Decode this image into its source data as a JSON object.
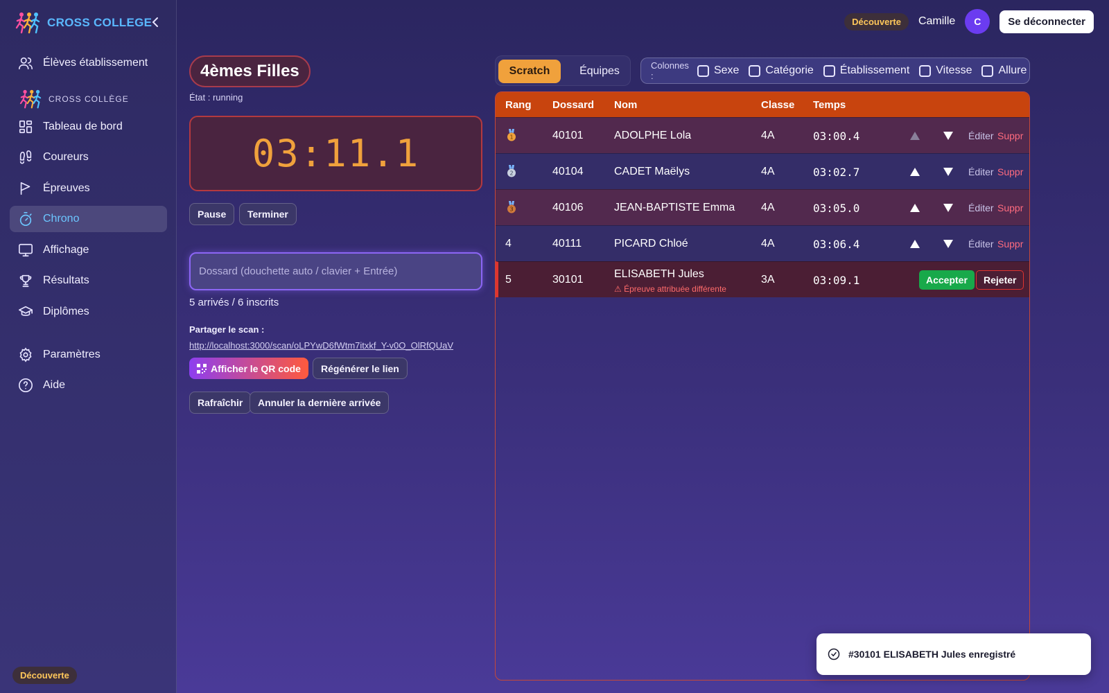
{
  "app": {
    "brand": "CROSS COLLEGE",
    "section_label": "CROSS COLLÈGE",
    "plan_badge": "Découverte"
  },
  "colors": {
    "accent_blue": "#5ab8ff",
    "accent_orange": "#f0a13c",
    "header_red": "#c8440e",
    "accept_green": "#18a94a"
  },
  "sidebar": {
    "items": [
      {
        "label": "Élèves établissement",
        "icon": "users-icon"
      },
      {
        "label": "Tableau de bord",
        "icon": "dashboard-icon"
      },
      {
        "label": "Coureurs",
        "icon": "footprints-icon"
      },
      {
        "label": "Épreuves",
        "icon": "flag-icon"
      },
      {
        "label": "Chrono",
        "icon": "stopwatch-icon",
        "active": true
      },
      {
        "label": "Affichage",
        "icon": "monitor-icon"
      },
      {
        "label": "Résultats",
        "icon": "trophy-icon"
      },
      {
        "label": "Diplômes",
        "icon": "graduation-cap-icon"
      },
      {
        "label": "Paramètres",
        "icon": "gear-icon"
      },
      {
        "label": "Aide",
        "icon": "help-circle-icon"
      }
    ]
  },
  "topbar": {
    "plan_badge": "Découverte",
    "user_name": "Camille",
    "avatar_initial": "C",
    "logout_label": "Se déconnecter"
  },
  "race": {
    "title": "4èmes Filles",
    "state": "État : running",
    "timer": "03:11.1",
    "pause_label": "Pause",
    "finish_label": "Terminer",
    "bib_placeholder": "Dossard (douchette auto / clavier + Entrée)",
    "arrivals": "5 arrivés / 6 inscrits",
    "share_label": "Partager le scan :",
    "share_link": "http://localhost:3000/scan/oLPYwD6fWtm7itxkf_Y-v0O_OlRfQUaV",
    "qr_label": "Afficher le QR code",
    "regen_label": "Régénérer le lien",
    "refresh_label": "Rafraîchir",
    "undo_label": "Annuler la dernière arrivée"
  },
  "results": {
    "tabs": [
      "Scratch",
      "Équipes"
    ],
    "columns_label": "Colonnes :",
    "column_options": [
      "Sexe",
      "Catégorie",
      "Établissement",
      "Vitesse",
      "Allure"
    ],
    "headers": {
      "rank": "Rang",
      "bib": "Dossard",
      "name": "Nom",
      "class": "Classe",
      "time": "Temps"
    },
    "edit_label": "Éditer",
    "delete_label": "Suppr",
    "rows": [
      {
        "rank": "",
        "medal": "gold",
        "bib": "40101",
        "name": "ADOLPHE Lola",
        "class": "4A",
        "time": "03:00.4"
      },
      {
        "rank": "",
        "medal": "silver",
        "bib": "40104",
        "name": "CADET Maëlys",
        "class": "4A",
        "time": "03:02.7"
      },
      {
        "rank": "",
        "medal": "bronze",
        "bib": "40106",
        "name": "JEAN-BAPTISTE Emma",
        "class": "4A",
        "time": "03:05.0"
      },
      {
        "rank": "4",
        "bib": "40111",
        "name": "PICARD Chloé",
        "class": "4A",
        "time": "03:06.4"
      }
    ],
    "pending": {
      "rank": "5",
      "bib": "30101",
      "name": "ELISABETH Jules",
      "class": "3A",
      "time": "03:09.1",
      "warning": "⚠ Épreuve attribuée différente",
      "accept_label": "Accepter",
      "reject_label": "Rejeter"
    }
  },
  "toast": {
    "message": "#30101 ELISABETH Jules enregistré"
  }
}
